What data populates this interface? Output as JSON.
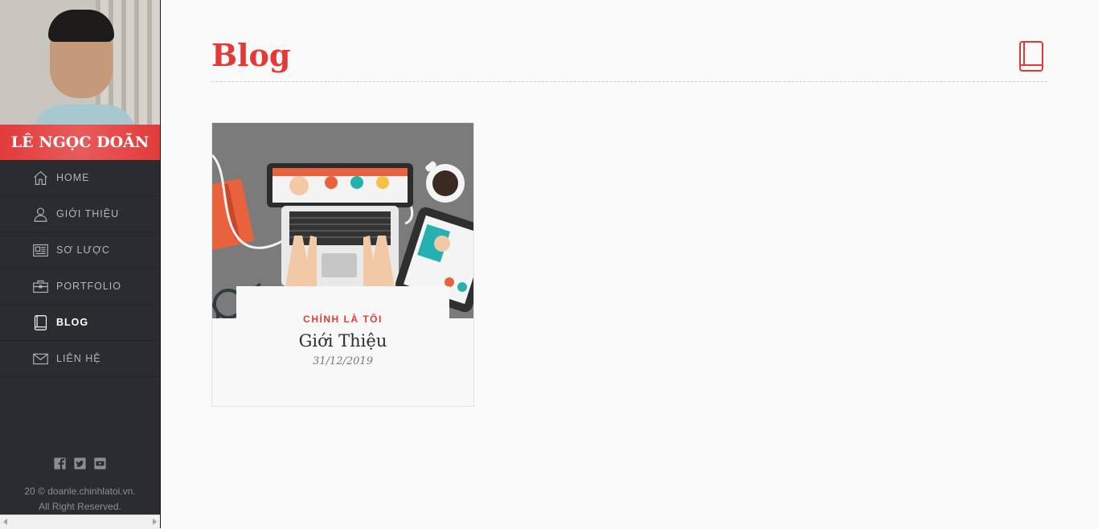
{
  "profile": {
    "name": "LÊ NGỌC DOÃN"
  },
  "nav": {
    "items": [
      {
        "label": "HOME",
        "icon": "home-icon",
        "active": false
      },
      {
        "label": "GIỚI THIỆU",
        "icon": "user-icon",
        "active": false
      },
      {
        "label": "SƠ LƯỢC",
        "icon": "newspaper-icon",
        "active": false
      },
      {
        "label": "PORTFOLIO",
        "icon": "briefcase-icon",
        "active": false
      },
      {
        "label": "BLOG",
        "icon": "book-icon",
        "active": true
      },
      {
        "label": "LIÊN HỆ",
        "icon": "envelope-icon",
        "active": false
      }
    ]
  },
  "social": [
    "facebook-icon",
    "twitter-icon",
    "youtube-icon"
  ],
  "footer": {
    "line1": "20 © doanle.chinhlatoi.vn.",
    "line2": "All Right Reserved."
  },
  "page": {
    "title": "Blog",
    "icon": "book-icon",
    "accent": "#e53935"
  },
  "posts": [
    {
      "category": "CHÍNH LÀ TÔI",
      "title": "Giới Thiệu",
      "date": "31/12/2019"
    }
  ]
}
